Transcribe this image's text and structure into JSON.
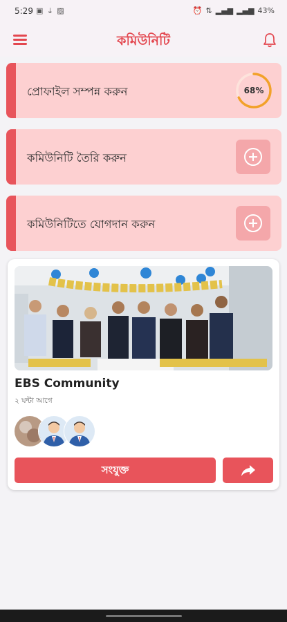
{
  "status_bar": {
    "time": "5:29",
    "battery": "43%"
  },
  "app_bar": {
    "title": "কমিউনিটি"
  },
  "actions": [
    {
      "label": "প্রোফাইল সম্পন্ন করুন",
      "progress_text": "68%",
      "progress": 0.68
    },
    {
      "label": "কমিউনিটি তৈরি করুন"
    },
    {
      "label": "কমিউনিটিতে যোগদান করুন"
    }
  ],
  "community": {
    "name": "EBS Community",
    "time_ago": "২ ঘন্টা আগে",
    "join_label": "সংযুক্ত"
  },
  "colors": {
    "accent": "#e8545b",
    "card_bg": "#fdd0d1",
    "progress_ring": "#f2a12a"
  }
}
